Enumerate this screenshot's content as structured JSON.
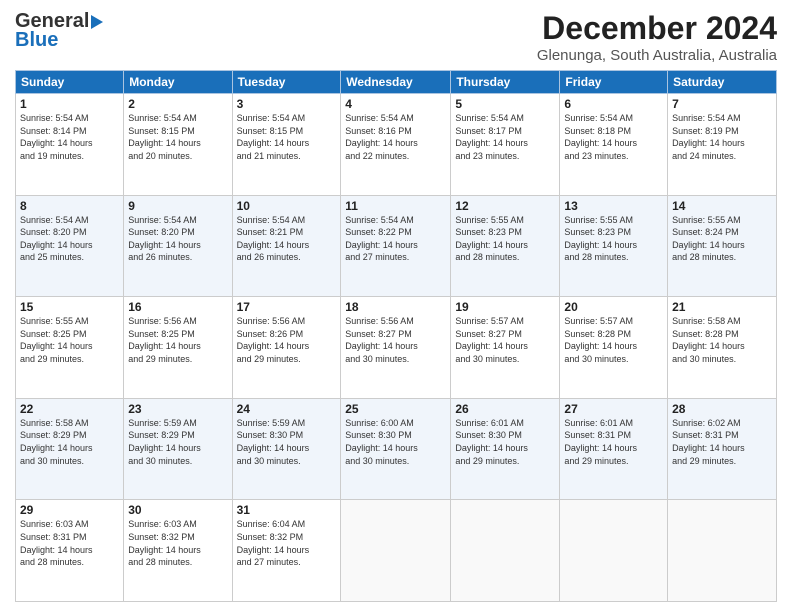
{
  "header": {
    "logo_line1": "General",
    "logo_line2": "Blue",
    "title": "December 2024",
    "subtitle": "Glenunga, South Australia, Australia"
  },
  "calendar": {
    "days_of_week": [
      "Sunday",
      "Monday",
      "Tuesday",
      "Wednesday",
      "Thursday",
      "Friday",
      "Saturday"
    ],
    "weeks": [
      [
        null,
        {
          "day": "2",
          "info": "Sunrise: 5:54 AM\nSunset: 8:15 PM\nDaylight: 14 hours\nand 20 minutes."
        },
        {
          "day": "3",
          "info": "Sunrise: 5:54 AM\nSunset: 8:15 PM\nDaylight: 14 hours\nand 21 minutes."
        },
        {
          "day": "4",
          "info": "Sunrise: 5:54 AM\nSunset: 8:16 PM\nDaylight: 14 hours\nand 22 minutes."
        },
        {
          "day": "5",
          "info": "Sunrise: 5:54 AM\nSunset: 8:17 PM\nDaylight: 14 hours\nand 23 minutes."
        },
        {
          "day": "6",
          "info": "Sunrise: 5:54 AM\nSunset: 8:18 PM\nDaylight: 14 hours\nand 23 minutes."
        },
        {
          "day": "7",
          "info": "Sunrise: 5:54 AM\nSunset: 8:19 PM\nDaylight: 14 hours\nand 24 minutes."
        }
      ],
      [
        {
          "day": "1",
          "info": "Sunrise: 5:54 AM\nSunset: 8:14 PM\nDaylight: 14 hours\nand 19 minutes."
        },
        {
          "day": "9",
          "info": "Sunrise: 5:54 AM\nSunset: 8:20 PM\nDaylight: 14 hours\nand 26 minutes."
        },
        {
          "day": "10",
          "info": "Sunrise: 5:54 AM\nSunset: 8:21 PM\nDaylight: 14 hours\nand 26 minutes."
        },
        {
          "day": "11",
          "info": "Sunrise: 5:54 AM\nSunset: 8:22 PM\nDaylight: 14 hours\nand 27 minutes."
        },
        {
          "day": "12",
          "info": "Sunrise: 5:55 AM\nSunset: 8:23 PM\nDaylight: 14 hours\nand 28 minutes."
        },
        {
          "day": "13",
          "info": "Sunrise: 5:55 AM\nSunset: 8:23 PM\nDaylight: 14 hours\nand 28 minutes."
        },
        {
          "day": "14",
          "info": "Sunrise: 5:55 AM\nSunset: 8:24 PM\nDaylight: 14 hours\nand 28 minutes."
        }
      ],
      [
        {
          "day": "8",
          "info": "Sunrise: 5:54 AM\nSunset: 8:20 PM\nDaylight: 14 hours\nand 25 minutes."
        },
        {
          "day": "16",
          "info": "Sunrise: 5:56 AM\nSunset: 8:25 PM\nDaylight: 14 hours\nand 29 minutes."
        },
        {
          "day": "17",
          "info": "Sunrise: 5:56 AM\nSunset: 8:26 PM\nDaylight: 14 hours\nand 29 minutes."
        },
        {
          "day": "18",
          "info": "Sunrise: 5:56 AM\nSunset: 8:27 PM\nDaylight: 14 hours\nand 30 minutes."
        },
        {
          "day": "19",
          "info": "Sunrise: 5:57 AM\nSunset: 8:27 PM\nDaylight: 14 hours\nand 30 minutes."
        },
        {
          "day": "20",
          "info": "Sunrise: 5:57 AM\nSunset: 8:28 PM\nDaylight: 14 hours\nand 30 minutes."
        },
        {
          "day": "21",
          "info": "Sunrise: 5:58 AM\nSunset: 8:28 PM\nDaylight: 14 hours\nand 30 minutes."
        }
      ],
      [
        {
          "day": "15",
          "info": "Sunrise: 5:55 AM\nSunset: 8:25 PM\nDaylight: 14 hours\nand 29 minutes."
        },
        {
          "day": "23",
          "info": "Sunrise: 5:59 AM\nSunset: 8:29 PM\nDaylight: 14 hours\nand 30 minutes."
        },
        {
          "day": "24",
          "info": "Sunrise: 5:59 AM\nSunset: 8:30 PM\nDaylight: 14 hours\nand 30 minutes."
        },
        {
          "day": "25",
          "info": "Sunrise: 6:00 AM\nSunset: 8:30 PM\nDaylight: 14 hours\nand 30 minutes."
        },
        {
          "day": "26",
          "info": "Sunrise: 6:01 AM\nSunset: 8:30 PM\nDaylight: 14 hours\nand 29 minutes."
        },
        {
          "day": "27",
          "info": "Sunrise: 6:01 AM\nSunset: 8:31 PM\nDaylight: 14 hours\nand 29 minutes."
        },
        {
          "day": "28",
          "info": "Sunrise: 6:02 AM\nSunset: 8:31 PM\nDaylight: 14 hours\nand 29 minutes."
        }
      ],
      [
        {
          "day": "22",
          "info": "Sunrise: 5:58 AM\nSunset: 8:29 PM\nDaylight: 14 hours\nand 30 minutes."
        },
        {
          "day": "30",
          "info": "Sunrise: 6:03 AM\nSunset: 8:32 PM\nDaylight: 14 hours\nand 28 minutes."
        },
        {
          "day": "31",
          "info": "Sunrise: 6:04 AM\nSunset: 8:32 PM\nDaylight: 14 hours\nand 27 minutes."
        },
        null,
        null,
        null,
        null
      ]
    ],
    "week1_sunday": {
      "day": "1",
      "info": "Sunrise: 5:54 AM\nSunset: 8:14 PM\nDaylight: 14 hours\nand 19 minutes."
    },
    "week2_sunday": {
      "day": "8",
      "info": "Sunrise: 5:54 AM\nSunset: 8:20 PM\nDaylight: 14 hours\nand 25 minutes."
    },
    "week3_sunday": {
      "day": "15",
      "info": "Sunrise: 5:55 AM\nSunset: 8:25 PM\nDaylight: 14 hours\nand 29 minutes."
    },
    "week4_sunday": {
      "day": "22",
      "info": "Sunrise: 5:58 AM\nSunset: 8:29 PM\nDaylight: 14 hours\nand 30 minutes."
    },
    "week5_sunday": {
      "day": "29",
      "info": "Sunrise: 6:03 AM\nSunset: 8:31 PM\nDaylight: 14 hours\nand 28 minutes."
    }
  }
}
